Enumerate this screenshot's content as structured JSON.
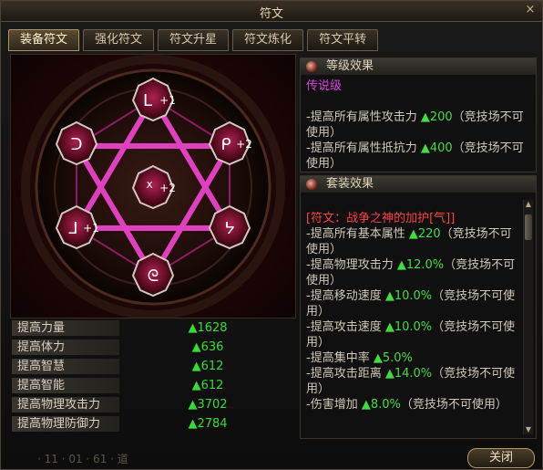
{
  "window": {
    "title": "符文",
    "close_icon": "×"
  },
  "tabs": [
    "装备符文",
    "强化符文",
    "符文升星",
    "符文炼化",
    "符文平转"
  ],
  "runes": [
    {
      "glyph": "ᒪ",
      "badge": "+1"
    },
    {
      "glyph": "ᑭ",
      "badge": "+2"
    },
    {
      "glyph": "ᔭ",
      "badge": ""
    },
    {
      "glyph": "ᘓ",
      "badge": ""
    },
    {
      "glyph": "ᒧ",
      "badge": "+1"
    },
    {
      "glyph": "ᑐ",
      "badge": ""
    },
    {
      "glyph": "ᕁ",
      "badge": "+2"
    }
  ],
  "stats": [
    {
      "label": "提高力量",
      "value": "▲1628"
    },
    {
      "label": "提高体力",
      "value": "▲636"
    },
    {
      "label": "提高智慧",
      "value": "▲612"
    },
    {
      "label": "提高智能",
      "value": "▲612"
    },
    {
      "label": "提高物理攻击力",
      "value": "▲3702"
    },
    {
      "label": "提高物理防御力",
      "value": "▲2784"
    }
  ],
  "level_panel": {
    "header": "等级效果",
    "grade": "传说级",
    "lines": [
      {
        "text": "-提高所有属性攻击力 ",
        "value": "▲200",
        "note": "（竞技场不可使用）"
      },
      {
        "text": "-提高所有属性抵抗力 ",
        "value": "▲400",
        "note": "（竞技场不可使用）"
      }
    ]
  },
  "set_panel": {
    "header": "套装效果",
    "set_name": "[符文：战争之神的加护[气]]",
    "lines": [
      {
        "text": "-提高所有基本属性 ",
        "value": "▲220",
        "note": "（竞技场不可使用）"
      },
      {
        "text": "-提高物理攻击力 ",
        "value": "▲12.0%",
        "note": "（竞技场不可使用）"
      },
      {
        "text": "-提高移动速度 ",
        "value": "▲10.0%",
        "note": "（竞技场不可使用）"
      },
      {
        "text": "-提高攻击速度 ",
        "value": "▲10.0%",
        "note": "（竞技场不可使用）"
      },
      {
        "text": "-提高集中率 ",
        "value": "▲5.0%",
        "note": ""
      },
      {
        "text": "-提高攻击距离 ",
        "value": "▲14.0%",
        "note": "（竞技场不可使用）"
      },
      {
        "text": "-伤害增加 ",
        "value": "▲8.0%",
        "note": "（竞技场不可使用）"
      }
    ]
  },
  "bottom_text": "· 11 · 01 · 61 · 道",
  "close_button": "关闭"
}
